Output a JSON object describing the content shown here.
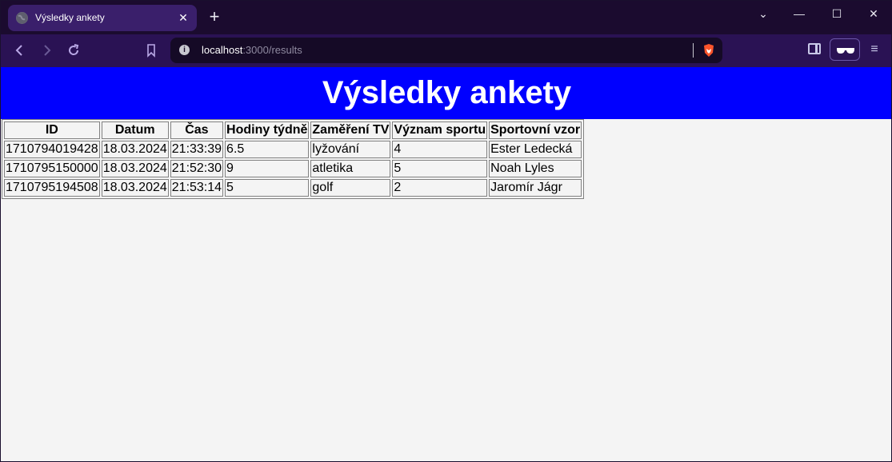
{
  "browser": {
    "tab_title": "Výsledky ankety",
    "tab_close": "✕",
    "new_tab": "+",
    "url_host": "localhost",
    "url_rest": ":3000/results",
    "win_min": "—",
    "win_max": "☐",
    "win_close": "✕",
    "win_menu": "⌄"
  },
  "page": {
    "title": "Výsledky ankety"
  },
  "table": {
    "headers": [
      "ID",
      "Datum",
      "Čas",
      "Hodiny týdně",
      "Zaměření TV",
      "Význam sportu",
      "Sportovní vzor"
    ],
    "rows": [
      [
        "1710794019428",
        "18.03.2024",
        "21:33:39",
        "6.5",
        "lyžování",
        "4",
        "Ester Ledecká"
      ],
      [
        "1710795150000",
        "18.03.2024",
        "21:52:30",
        "9",
        "atletika",
        "5",
        "Noah Lyles"
      ],
      [
        "1710795194508",
        "18.03.2024",
        "21:53:14",
        "5",
        "golf",
        "2",
        "Jaromír Jágr"
      ]
    ]
  },
  "colors": {
    "header_bg": "#0000ff",
    "tabbar_bg": "#1b0b2f",
    "navbar_bg": "#2a1254"
  }
}
